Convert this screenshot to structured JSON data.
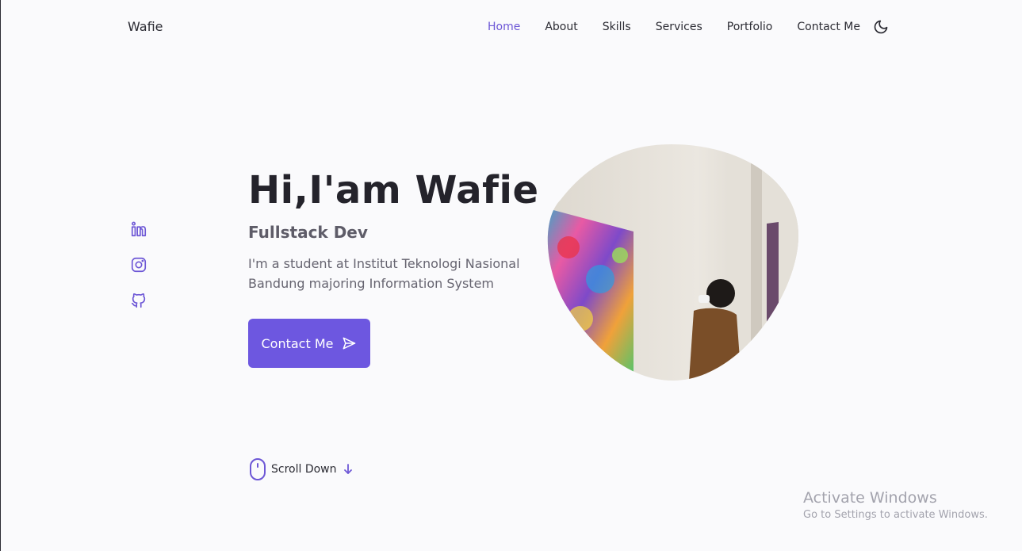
{
  "header": {
    "brand": "Wafie",
    "nav": [
      {
        "label": "Home",
        "active": true
      },
      {
        "label": "About",
        "active": false
      },
      {
        "label": "Skills",
        "active": false
      },
      {
        "label": "Services",
        "active": false
      },
      {
        "label": "Portfolio",
        "active": false
      },
      {
        "label": "Contact Me",
        "active": false
      }
    ],
    "theme_icon": "moon-icon"
  },
  "social": [
    {
      "icon": "linkedin-icon"
    },
    {
      "icon": "instagram-icon"
    },
    {
      "icon": "github-icon"
    }
  ],
  "hero": {
    "title": "Hi,I'am Wafie",
    "subtitle": "Fullstack Dev",
    "description": "I'm a student at Institut Teknologi Nasional Bandung majoring Information System",
    "button_label": "Contact Me",
    "button_icon": "send-icon"
  },
  "scroll": {
    "label": "Scroll Down",
    "icon": "mouse-icon",
    "arrow_icon": "arrow-down-icon"
  },
  "watermark": {
    "title": "Activate Windows",
    "subtitle": "Go to Settings to activate Windows."
  },
  "colors": {
    "accent": "#6d57e0",
    "background": "#fafafc",
    "text": "#2b2b33"
  }
}
